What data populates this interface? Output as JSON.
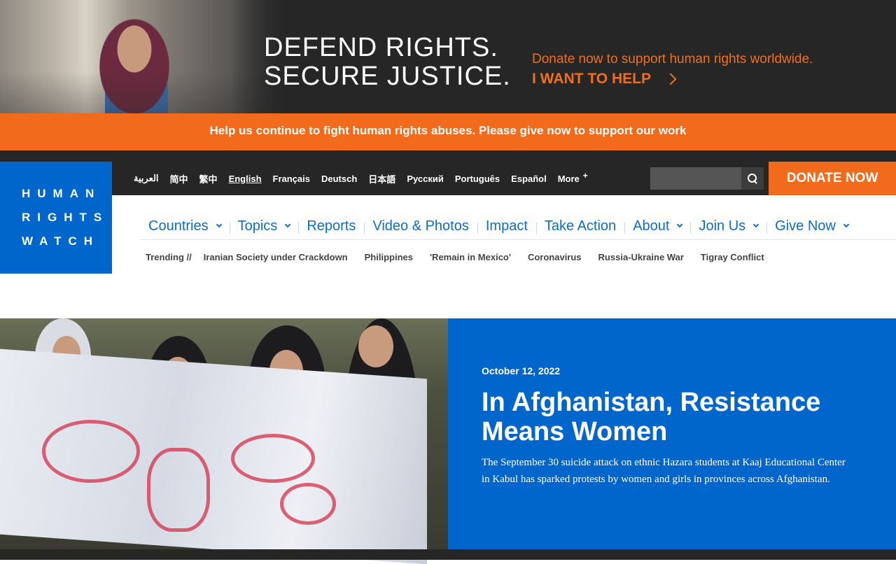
{
  "banner": {
    "headline_line1": "DEFEND RIGHTS.",
    "headline_line2": "SECURE JUSTICE.",
    "subtext": "Donate now to support human rights worldwide.",
    "cta": "I WANT TO HELP"
  },
  "strip": {
    "text": "Help us continue to fight human rights abuses. Please give now to support our work"
  },
  "logo": {
    "line1": "HUMAN",
    "line2": "RIGHTS",
    "line3": "WATCH"
  },
  "languages": [
    {
      "label": "العربية",
      "active": false
    },
    {
      "label": "简中",
      "active": false
    },
    {
      "label": "繁中",
      "active": false
    },
    {
      "label": "English",
      "active": true
    },
    {
      "label": "Français",
      "active": false
    },
    {
      "label": "Deutsch",
      "active": false
    },
    {
      "label": "日本語",
      "active": false
    },
    {
      "label": "Русский",
      "active": false
    },
    {
      "label": "Português",
      "active": false
    },
    {
      "label": "Español",
      "active": false
    }
  ],
  "more_label": "More",
  "search": {
    "placeholder": ""
  },
  "donate_label": "DONATE NOW",
  "nav": [
    {
      "label": "Countries",
      "dropdown": true
    },
    {
      "label": "Topics",
      "dropdown": true
    },
    {
      "label": "Reports",
      "dropdown": false
    },
    {
      "label": "Video & Photos",
      "dropdown": false
    },
    {
      "label": "Impact",
      "dropdown": false
    },
    {
      "label": "Take Action",
      "dropdown": false
    },
    {
      "label": "About",
      "dropdown": true
    },
    {
      "label": "Join Us",
      "dropdown": true
    },
    {
      "label": "Give Now",
      "dropdown": true
    }
  ],
  "trending": {
    "label": "Trending //",
    "items": [
      "Iranian Society under Crackdown",
      "Philippines",
      "'Remain in Mexico'",
      "Coronavirus",
      "Russia-Ukraine War",
      "Tigray Conflict"
    ]
  },
  "feature": {
    "date": "October 12, 2022",
    "title": "In Afghanistan, Resistance Means Women",
    "description": "The September 30 suicide attack on ethnic Hazara students at Kaaj Educational Center in Kabul has sparked protests by women and girls in provinces across Afghanistan."
  },
  "colors": {
    "brand_blue": "#0066cc",
    "accent_orange": "#f26b1d",
    "dark": "#262626"
  }
}
